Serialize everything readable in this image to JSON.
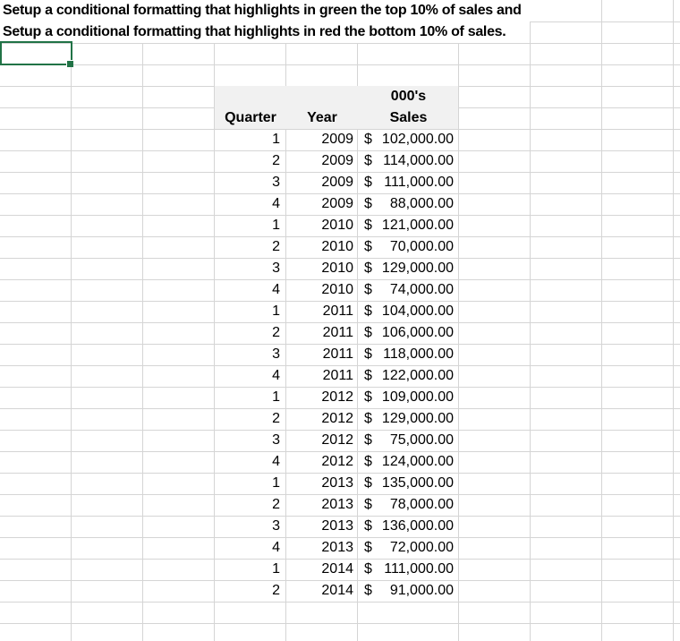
{
  "instructions": {
    "line1": "Setup a conditional formatting that highlights in green the top 10% of sales and",
    "line2": "Setup a conditional formatting that highlights in red the bottom 10% of sales."
  },
  "table": {
    "units_label": "000's",
    "headers": {
      "quarter": "Quarter",
      "year": "Year",
      "sales": "Sales"
    },
    "currency_symbol": "$",
    "rows": [
      {
        "quarter": "1",
        "year": "2009",
        "sales": "102,000.00"
      },
      {
        "quarter": "2",
        "year": "2009",
        "sales": "114,000.00"
      },
      {
        "quarter": "3",
        "year": "2009",
        "sales": "111,000.00"
      },
      {
        "quarter": "4",
        "year": "2009",
        "sales": "88,000.00"
      },
      {
        "quarter": "1",
        "year": "2010",
        "sales": "121,000.00"
      },
      {
        "quarter": "2",
        "year": "2010",
        "sales": "70,000.00"
      },
      {
        "quarter": "3",
        "year": "2010",
        "sales": "129,000.00"
      },
      {
        "quarter": "4",
        "year": "2010",
        "sales": "74,000.00"
      },
      {
        "quarter": "1",
        "year": "2011",
        "sales": "104,000.00"
      },
      {
        "quarter": "2",
        "year": "2011",
        "sales": "106,000.00"
      },
      {
        "quarter": "3",
        "year": "2011",
        "sales": "118,000.00"
      },
      {
        "quarter": "4",
        "year": "2011",
        "sales": "122,000.00"
      },
      {
        "quarter": "1",
        "year": "2012",
        "sales": "109,000.00"
      },
      {
        "quarter": "2",
        "year": "2012",
        "sales": "129,000.00"
      },
      {
        "quarter": "3",
        "year": "2012",
        "sales": "75,000.00"
      },
      {
        "quarter": "4",
        "year": "2012",
        "sales": "124,000.00"
      },
      {
        "quarter": "1",
        "year": "2013",
        "sales": "135,000.00"
      },
      {
        "quarter": "2",
        "year": "2013",
        "sales": "78,000.00"
      },
      {
        "quarter": "3",
        "year": "2013",
        "sales": "136,000.00"
      },
      {
        "quarter": "4",
        "year": "2013",
        "sales": "72,000.00"
      },
      {
        "quarter": "1",
        "year": "2014",
        "sales": "111,000.00"
      },
      {
        "quarter": "2",
        "year": "2014",
        "sales": "91,000.00"
      }
    ]
  },
  "colors": {
    "selection_border": "#217346",
    "header_fill": "#f1f1f1",
    "gridline": "#d5d5d5",
    "text": "#000000",
    "background": "#ffffff"
  }
}
